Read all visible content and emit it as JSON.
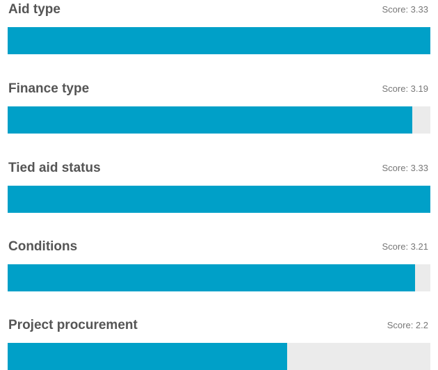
{
  "chart_data": {
    "type": "bar",
    "orientation": "horizontal",
    "categories": [
      "Aid type",
      "Finance type",
      "Tied aid status",
      "Conditions",
      "Project procurement"
    ],
    "values": [
      3.33,
      3.19,
      3.33,
      3.21,
      2.2
    ],
    "value_labels": [
      "Score: 3.33",
      "Score: 3.19",
      "Score: 3.33",
      "Score: 3.21",
      "Score: 2.2"
    ],
    "xlim": [
      0,
      3.33
    ],
    "colors": {
      "bar": "#00a0c8",
      "track": "#ebebeb"
    },
    "grid": false,
    "legend": "none"
  }
}
